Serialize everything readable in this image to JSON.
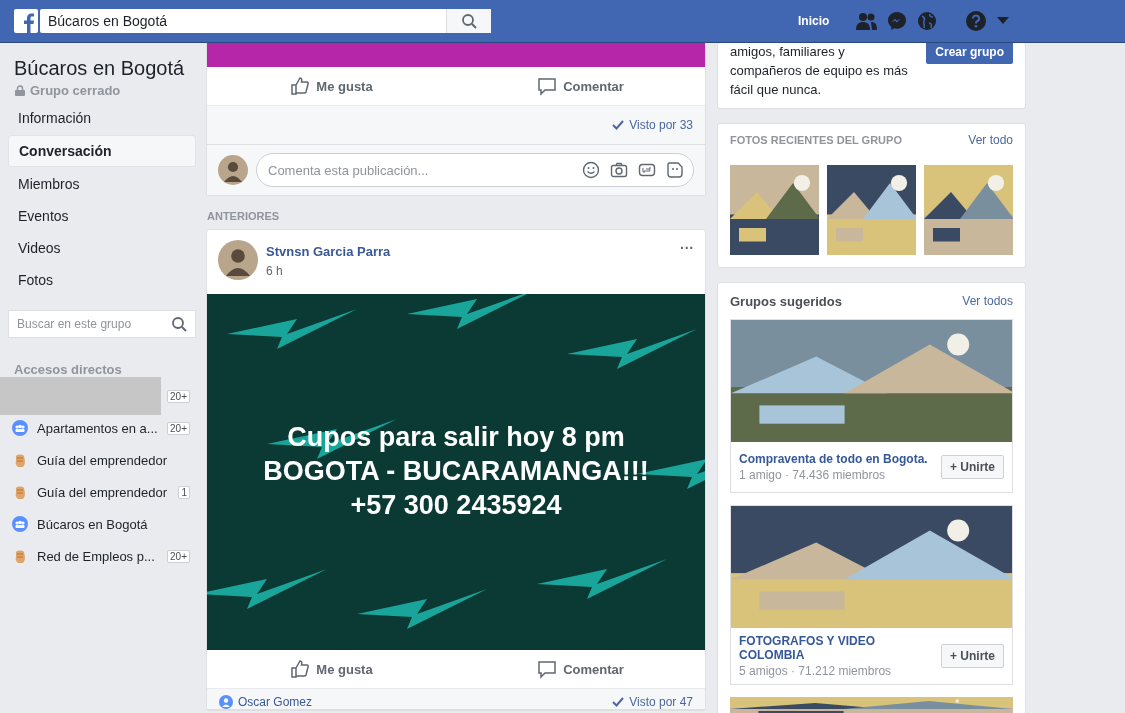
{
  "topbar": {
    "search_value": "Búcaros en Bogotá",
    "home": "Inicio"
  },
  "sidebar": {
    "group_name": "Búcaros en Bogotá",
    "privacy": "Grupo cerrado",
    "nav": [
      {
        "label": "Información",
        "selected": false
      },
      {
        "label": "Conversación",
        "selected": true
      },
      {
        "label": "Miembros",
        "selected": false
      },
      {
        "label": "Eventos",
        "selected": false
      },
      {
        "label": "Videos",
        "selected": false
      },
      {
        "label": "Fotos",
        "selected": false
      }
    ],
    "search_placeholder": "Buscar en este grupo",
    "shortcuts_title": "Accesos directos",
    "shortcuts": [
      {
        "kind": "hidden",
        "badge": "20+"
      },
      {
        "kind": "group",
        "label": "Apartamentos en a...",
        "badge": "20+"
      },
      {
        "kind": "page",
        "label": "Guía del emprendedor"
      },
      {
        "kind": "page",
        "label": "Guía del emprendedor",
        "badge": "1"
      },
      {
        "kind": "group",
        "label": "Búcaros en Bogotá"
      },
      {
        "kind": "page",
        "label": "Red de Empleos p...",
        "badge": "20+"
      }
    ]
  },
  "feed": {
    "previous_post": {
      "like": "Me gusta",
      "comment": "Comentar",
      "seen": "Visto por 33",
      "comment_placeholder": "Comenta esta publicación..."
    },
    "section_label": "ANTERIORES",
    "post": {
      "author": "Stvnsn Garcia Parra",
      "time": "6 h",
      "menu": "···",
      "text_lines": [
        "Cupos para salir hoy 8 pm",
        "BOGOTA - BUCARAMANGA!!!",
        "+57 300 2435924"
      ],
      "like": "Me gusta",
      "comment": "Comentar",
      "commenter": "Oscar Gomez",
      "seen": "Visto por 47"
    }
  },
  "right": {
    "create_text": "amigos, familiares y compañeros de equipo es más fácil que nunca.",
    "create_button": "Crear grupo",
    "photos": {
      "title": "FOTOS RECIENTES DEL GRUPO",
      "link": "Ver todo"
    },
    "suggested": {
      "title": "Grupos sugeridos",
      "link": "Ver todos",
      "groups": [
        {
          "name": "Compraventa de todo en Bogota.",
          "meta": "1 amigo · 74.436 miembros",
          "join": "+ Unirte"
        },
        {
          "name": "FOTOGRAFOS Y VIDEO COLOMBIA",
          "meta": "5 amigos · 71.212 miembros",
          "join": "+ Unirte"
        }
      ]
    }
  }
}
